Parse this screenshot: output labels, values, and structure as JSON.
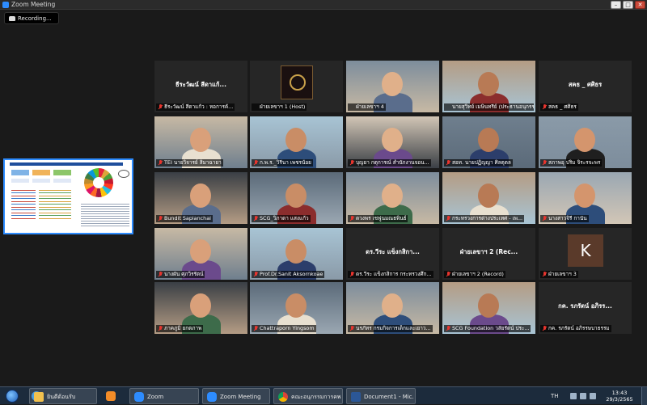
{
  "window": {
    "title": "Zoom Meeting",
    "controls": [
      "–",
      "□",
      "✕"
    ]
  },
  "recording": {
    "label": "Recording..."
  },
  "shared_screen": {
    "label": "shared-screen-thumbnail"
  },
  "gallery": [
    {
      "caption": "ธีระวัฒน์ สีดาแก้ว : หอการค้...",
      "center_name": "ธีระวัฒน์ สีดาแก้...",
      "type": "name",
      "muted": true
    },
    {
      "caption": "ฝ่ายเลขาฯ 1 (Host)",
      "center_name": "",
      "type": "logo",
      "muted": false
    },
    {
      "caption": "ฝ่ายเลขาฯ 4",
      "center_name": "",
      "type": "video",
      "muted": false,
      "active": true
    },
    {
      "caption": "นายสุวิทย์ เมษินทรีย์ (ประธานอนุกรรม...",
      "center_name": "",
      "type": "video",
      "muted": false
    },
    {
      "caption": "สคธ _ ศศิธร",
      "center_name": "สคธ _ ศศิธร",
      "type": "name",
      "muted": true
    },
    {
      "caption": "TEI นายวิจารย์ สิมาฉายา",
      "center_name": "",
      "type": "video",
      "muted": true
    },
    {
      "caption": "ก.พ.ร._วิรีนา เพชรน้อย",
      "center_name": "",
      "type": "video",
      "muted": true
    },
    {
      "caption": "บุญยา กตุการณ์ สำนักงานจอน...",
      "center_name": "",
      "type": "video",
      "muted": true
    },
    {
      "caption": "สอท. นายปฏิญญา ศิลตุตล",
      "center_name": "",
      "type": "video",
      "muted": true
    },
    {
      "caption": "สภาพอุ ปริม จิระรจะพร",
      "center_name": "",
      "type": "video",
      "muted": true
    },
    {
      "caption": "Bundit Sapianchai",
      "center_name": "",
      "type": "video",
      "muted": true
    },
    {
      "caption": "SCG_วิภาดา แสงแก้ว",
      "center_name": "",
      "type": "video",
      "muted": true
    },
    {
      "caption": "ดวงพร เชฟูนมณธพินธ์",
      "center_name": "",
      "type": "video",
      "muted": true
    },
    {
      "caption": "กระทรวงการต่างประเทศ - เพ...",
      "center_name": "",
      "type": "video",
      "muted": true
    },
    {
      "caption": "นางสาวจิรี กานัน",
      "center_name": "",
      "type": "video",
      "muted": true
    },
    {
      "caption": "นางผัน ศุภวิรรัตน์",
      "center_name": "",
      "type": "video",
      "muted": true
    },
    {
      "caption": "Prof.Dr.Sanit Aksornkoae",
      "center_name": "",
      "type": "video",
      "muted": true
    },
    {
      "caption": "ดร.วีระ แข็งกสิการ กระทรวงศึก...",
      "center_name": "ดร.วีระ แข็งกสิกา...",
      "type": "name",
      "muted": true
    },
    {
      "caption": "ฝ่ายเลขาฯ 2 (Record)",
      "center_name": "ฝ่ายเลขาฯ 2 (Rec...",
      "type": "name",
      "muted": true
    },
    {
      "caption": "ฝ่ายเลขาฯ 3",
      "center_name": "",
      "type": "avatar",
      "avatar_letter": "K",
      "muted": true
    },
    {
      "caption": "ภาคภูมิ ยกตภาพ",
      "center_name": "",
      "type": "video",
      "muted": true
    },
    {
      "caption": "Chattraporn Yingsom",
      "center_name": "",
      "type": "video",
      "muted": true
    },
    {
      "caption": "นรภัทร กรมกิจการเด็กและเยาว...",
      "center_name": "",
      "type": "video",
      "muted": true
    },
    {
      "caption": "SCG Foundation วลัยรัตน์ ประ...",
      "center_name": "",
      "type": "video",
      "muted": true
    },
    {
      "caption": "กค. รภรัตน์ อภิรรษบาธรรม",
      "center_name": "กค. รภรัตน์ อภิรร...",
      "type": "name",
      "muted": true
    }
  ],
  "taskbar": {
    "items": [
      {
        "label": "",
        "kind": "ie"
      },
      {
        "label": "ยินดีต้อนรับ",
        "kind": "folder"
      },
      {
        "label": "",
        "kind": "media"
      },
      {
        "label": "Zoom",
        "kind": "zoom"
      },
      {
        "label": "Zoom Meeting",
        "kind": "zoom"
      },
      {
        "label": "คณะอนุกรรมการคพ...",
        "kind": "chrome"
      },
      {
        "label": "Document1 - Mic...",
        "kind": "word"
      }
    ],
    "tray": {
      "lang": "TH",
      "time": "13:43",
      "date": "29/3/2565"
    }
  },
  "colors": {
    "accent": "#2d8cff",
    "active_border": "#b7e05a",
    "mute_red": "#e8352e",
    "taskbar": "#1c2b3c"
  }
}
